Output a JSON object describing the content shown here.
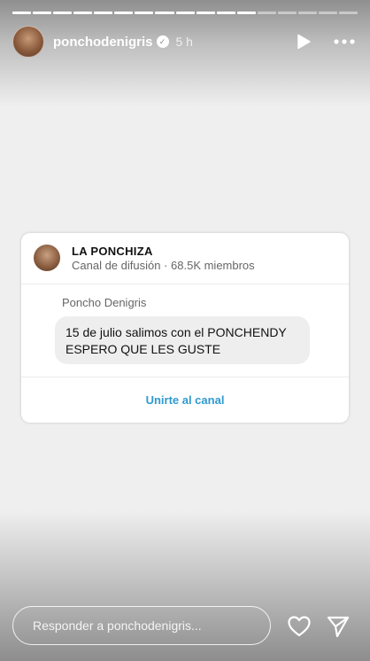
{
  "story": {
    "progress": {
      "total_segments": 17,
      "completed_segments": 12
    },
    "header": {
      "username": "ponchodenigris",
      "time": "5 h",
      "icons": {
        "verified": "verified-badge-icon",
        "play": "play-icon",
        "more": "more-icon"
      }
    }
  },
  "card": {
    "channel_name": "LA PONCHIZA",
    "channel_meta": "Canal de difusión · 68.5K miembros",
    "sender": "Poncho Denigris",
    "message_line1": "15 de julio salimos con el PONCHENDY",
    "message_line2": "ESPERO QUE LES GUSTE",
    "join_label": "Unirte al canal",
    "accent_color": "#2f9ad0"
  },
  "footer": {
    "reply_placeholder": "Responder a ponchodenigris...",
    "icons": {
      "like": "heart-icon",
      "send": "send-icon"
    }
  }
}
